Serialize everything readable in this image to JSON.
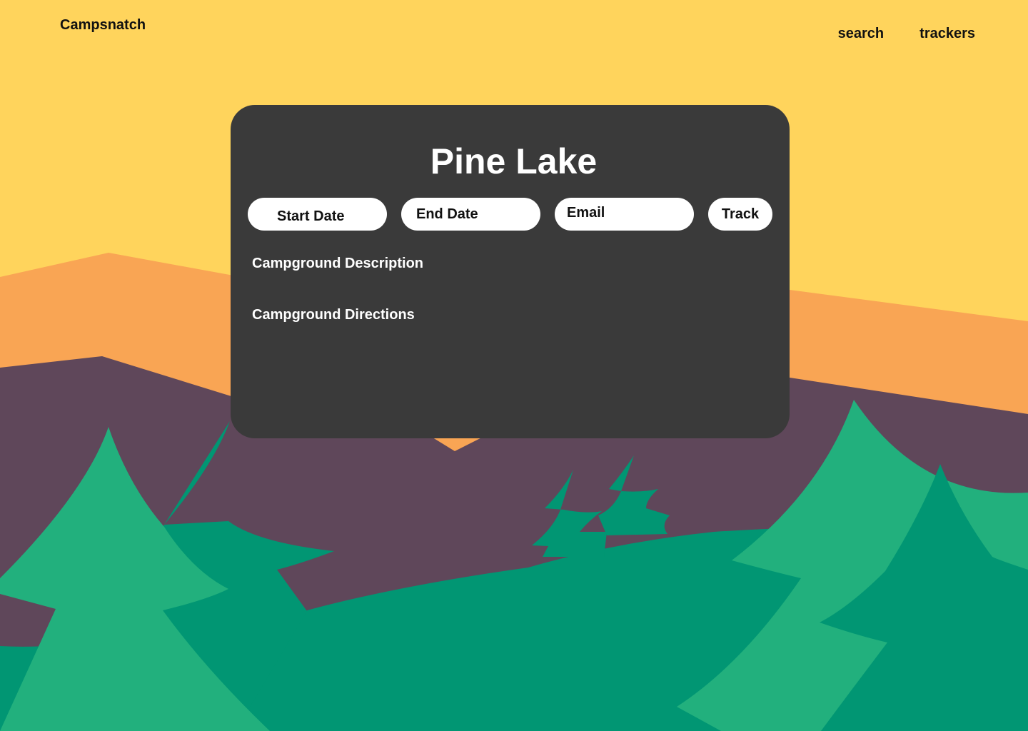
{
  "brand": {
    "name": "Campsnatch"
  },
  "nav": {
    "search": "search",
    "trackers": "trackers"
  },
  "campground": {
    "name": "Pine Lake",
    "description_label": "Campground Description",
    "directions_label": "Campground Directions"
  },
  "form": {
    "start_date": "Start Date",
    "end_date": "End Date",
    "email": "Email",
    "track_button": "Track"
  },
  "colors": {
    "sky": "#FFD45C",
    "far_mountain": "#F9A554",
    "mid_mountain": "#5F475A",
    "dark_tree": "#019673",
    "light_tree": "#22B07D",
    "card": "#3A3A3A"
  }
}
